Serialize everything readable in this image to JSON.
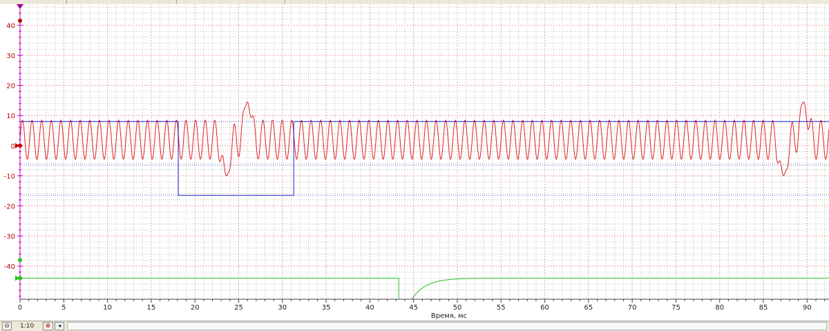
{
  "chart_data": {
    "type": "line",
    "xlabel": "Время, мс",
    "xlim": [
      0,
      92.5
    ],
    "ylim": [
      -51,
      47
    ],
    "x_ticks": [
      0,
      5,
      10,
      15,
      20,
      25,
      30,
      35,
      40,
      45,
      50,
      55,
      60,
      65,
      70,
      75,
      80,
      85,
      90
    ],
    "y_ticks": [
      40,
      30,
      20,
      10,
      0,
      -10,
      -20,
      -30,
      -40
    ],
    "grid": true,
    "series": [
      {
        "color": "#e02020",
        "kind": "sine",
        "amplitude": 6.5,
        "offset": 2,
        "period_ms": 1.1,
        "spikes": [
          {
            "x": 23.6,
            "y": -10
          },
          {
            "x": 26.0,
            "y": 14.5
          },
          {
            "x": 87.3,
            "y": -10
          },
          {
            "x": 89.6,
            "y": 14.5
          }
        ]
      },
      {
        "color": "#2020d0",
        "kind": "step",
        "points": [
          [
            0,
            8
          ],
          [
            18.1,
            8
          ],
          [
            18.1,
            -16.5
          ],
          [
            31.3,
            -16.5
          ],
          [
            31.3,
            8
          ],
          [
            92.5,
            8
          ]
        ]
      },
      {
        "color": "#20c020",
        "kind": "step",
        "points": [
          [
            0,
            -44
          ],
          [
            43.3,
            -44
          ],
          [
            43.3,
            -51
          ],
          [
            44.8,
            -51
          ]
        ],
        "recovery": {
          "from_x": 44.8,
          "from_y": -51,
          "to_y": -44,
          "tau_ms": 1.6,
          "to_x": 92.5
        }
      }
    ],
    "reference_lines": [
      {
        "y": 8,
        "color": "#4040e0",
        "style": "dotted"
      },
      {
        "y": -6.5,
        "color": "#6060f0",
        "style": "dotted"
      },
      {
        "y": -16.5,
        "color": "#6060f0",
        "style": "dotted"
      }
    ]
  },
  "toolbar": {
    "zoom_out_icon": "minus-circle-icon",
    "zoom_label": "1:10",
    "zoom_in_icon": "plus-circle-icon",
    "scroll_left_icon": "triangle-left-icon"
  }
}
